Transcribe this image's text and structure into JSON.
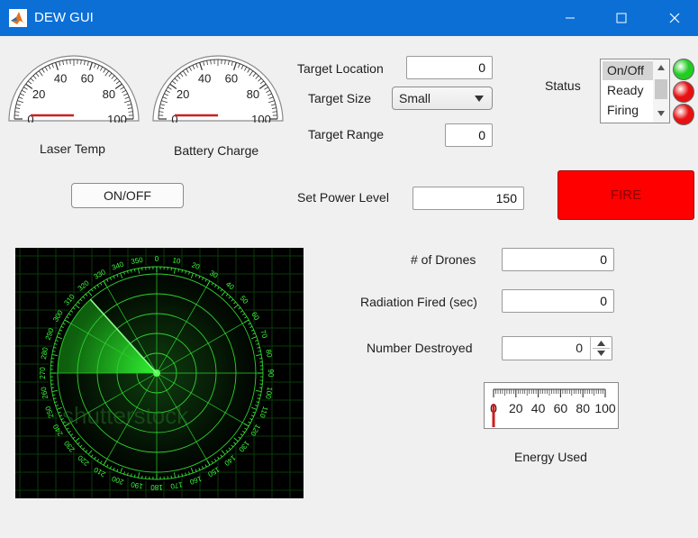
{
  "window": {
    "title": "DEW GUI",
    "app_icon": "matlab-icon",
    "controls": [
      "minimize-icon",
      "maximize-icon",
      "close-icon"
    ],
    "titlebar_color": "#0b6fd6"
  },
  "gauges": {
    "laser_temp": {
      "label": "Laser Temp",
      "ticks": [
        "0",
        "20",
        "40",
        "60",
        "80",
        "100"
      ],
      "value": 0
    },
    "battery_charge": {
      "label": "Battery Charge",
      "ticks": [
        "0",
        "20",
        "40",
        "60",
        "80",
        "100"
      ],
      "value": 0
    }
  },
  "on_off_button": {
    "label": "ON/OFF"
  },
  "target": {
    "location_label": "Target Location",
    "location_value": "0",
    "size_label": "Target Size",
    "size_value": "Small",
    "range_label": "Target Range",
    "range_value": "0"
  },
  "power": {
    "label": "Set Power Level",
    "value": "150"
  },
  "fire_button": {
    "label": "FIRE",
    "color": "#ff0000"
  },
  "status": {
    "label": "Status",
    "items": [
      "On/Off",
      "Ready",
      "Firing"
    ],
    "selected": "On/Off",
    "lamps": [
      {
        "name": "on-off-lamp",
        "color": "#22cc22"
      },
      {
        "name": "ready-lamp",
        "color": "#e81010"
      },
      {
        "name": "firing-lamp",
        "color": "#e81010"
      }
    ]
  },
  "radar": {
    "bearing_labels": [
      "0",
      "10",
      "20",
      "30",
      "40",
      "50",
      "60",
      "70",
      "80",
      "90",
      "100",
      "110",
      "120",
      "130",
      "140",
      "150",
      "160",
      "170",
      "180",
      "190",
      "200",
      "210",
      "220",
      "230",
      "240",
      "250",
      "260",
      "270",
      "280",
      "290",
      "300",
      "310",
      "320",
      "330",
      "340",
      "350"
    ],
    "watermark": "shutterstock"
  },
  "stats": {
    "drones_label": "# of  Drones",
    "drones_value": "0",
    "radiation_label": "Radiation Fired (sec)",
    "radiation_value": "0",
    "destroyed_label": "Number Destroyed",
    "destroyed_value": "0"
  },
  "energy": {
    "label": "Energy Used",
    "ticks": [
      "0",
      "20",
      "40",
      "60",
      "80",
      "100"
    ],
    "value": 0
  }
}
